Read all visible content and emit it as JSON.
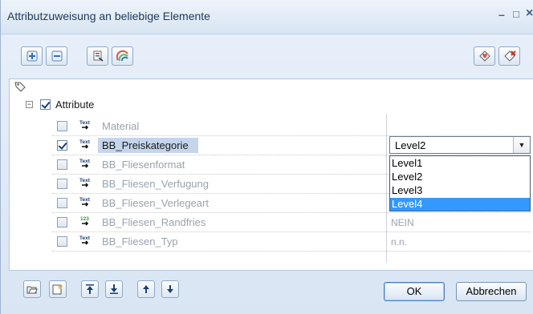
{
  "window": {
    "title": "Attributzuweisung an beliebige Elemente",
    "minimize_glyph": "–",
    "maximize_glyph": "□",
    "close_glyph": "×"
  },
  "toolbar": {
    "left_buttons": [
      "add-icon",
      "remove-icon",
      "numbering-icon",
      "palette-icon"
    ],
    "right_buttons": [
      "attribute-favorite-icon",
      "attribute-delete-icon"
    ]
  },
  "tree": {
    "root": {
      "label": "Attribute",
      "expanded": true,
      "checked": true
    },
    "items": [
      {
        "label": "Material",
        "type": "text",
        "checked": false,
        "value": "",
        "active": false
      },
      {
        "label": "BB_Preiskategorie",
        "type": "text",
        "checked": true,
        "value": "Level2",
        "active": true
      },
      {
        "label": "BB_Fliesenformat",
        "type": "text",
        "checked": false,
        "value": "",
        "active": false
      },
      {
        "label": "BB_Fliesen_Verfugung",
        "type": "text",
        "checked": false,
        "value": "",
        "active": false
      },
      {
        "label": "BB_Fliesen_Verlegeart",
        "type": "text",
        "checked": false,
        "value": "",
        "active": false
      },
      {
        "label": "BB_Fliesen_Randfries",
        "type": "number",
        "checked": false,
        "value": "NEIN",
        "active": false
      },
      {
        "label": "BB_Fliesen_Typ",
        "type": "text",
        "checked": false,
        "value": "n.n.",
        "active": false
      }
    ]
  },
  "combo": {
    "selected": "Level2",
    "options": [
      "Level1",
      "Level2",
      "Level3",
      "Level4"
    ],
    "highlighted_index": 3
  },
  "bottom": {
    "icon_buttons": [
      "open-folder-icon",
      "save-favorite-icon",
      "move-top-icon",
      "move-bottom-icon",
      "move-up-icon",
      "move-down-icon"
    ],
    "ok_label": "OK",
    "cancel_label": "Abbrechen"
  },
  "colors": {
    "selection": "#c4d5ec",
    "dropdown_highlight": "#3399ff",
    "title_text": "#1e395b",
    "inactive_text": "#9aa2ad"
  }
}
